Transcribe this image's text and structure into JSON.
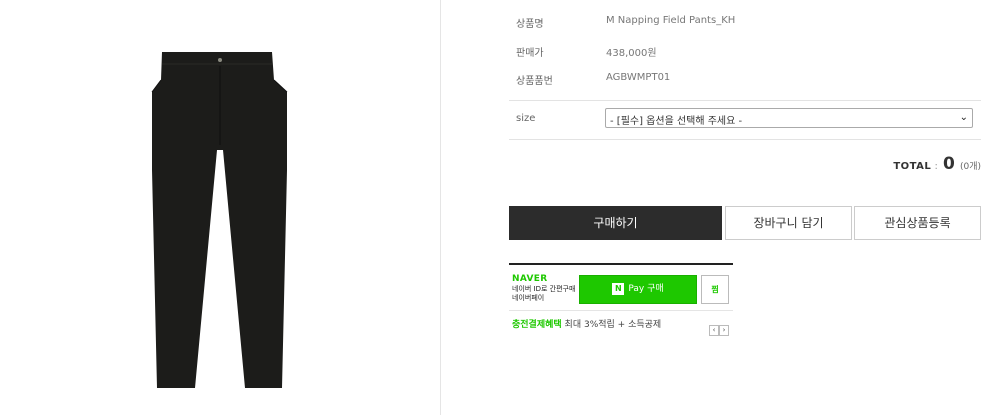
{
  "product": {
    "image_alt": "black trousers product photo",
    "fields": [
      {
        "label": "상품명",
        "value": "M Napping Field Pants_KH"
      },
      {
        "label": "판매가",
        "value": "438,000원"
      },
      {
        "label": "상품품번",
        "value": "AGBWMPT01"
      }
    ]
  },
  "options": {
    "size_label": "size",
    "size_selected": "- [필수] 옵션을 선택해 주세요 -"
  },
  "total": {
    "label": "TOTAL",
    "separator": " : ",
    "amount": "0",
    "count": "(0개)"
  },
  "buttons": {
    "buy": "구매하기",
    "cart": "장바구니 담기",
    "wishlist": "관심상품등록"
  },
  "naverpay": {
    "logo": "NAVER",
    "desc_line1": "네이버 ID로 간편구매",
    "desc_line2": "네이버페이",
    "pay_badge": "N",
    "pay_label": "Pay 구매",
    "zzim_label": "찜",
    "benefit_highlight": "충전결제혜택",
    "benefit_text": " 최대 3%적립 + 소득공제",
    "prev_icon": "‹",
    "next_icon": "›"
  },
  "colors": {
    "buy_button_bg": "#2c2c2c",
    "naver_green": "#1ec800"
  }
}
